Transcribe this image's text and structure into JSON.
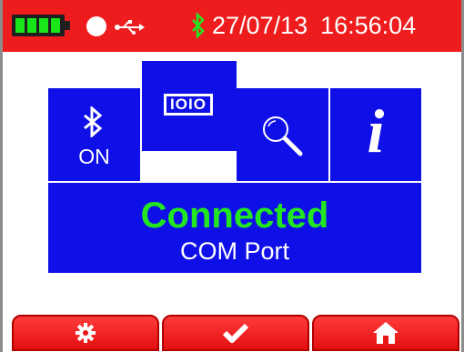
{
  "status_bar": {
    "date": "27/07/13",
    "time": "16:56:04",
    "battery_level": 1.0,
    "icons": [
      "battery-icon",
      "power-dot-icon",
      "usb-icon",
      "bluetooth-icon"
    ]
  },
  "tiles": {
    "bluetooth": {
      "icon": "bluetooth-icon",
      "label": "ON"
    },
    "com_port": {
      "icon": "io-port-icon",
      "glyph_text": "IOIO",
      "selected": true
    },
    "search": {
      "icon": "magnifier-icon"
    },
    "info": {
      "icon": "info-icon",
      "glyph_text": "i"
    }
  },
  "status_panel": {
    "status": "Connected",
    "detail": "COM Port"
  },
  "softkeys": [
    {
      "icon": "gear-icon"
    },
    {
      "icon": "checkmark-icon"
    },
    {
      "icon": "home-icon"
    }
  ],
  "colors": {
    "status_bar": "#ee1c1c",
    "tile_blue": "#0f0fe8",
    "connected_green": "#22e622",
    "battery_green": "#19e619",
    "softkey_red": "#ff3b3b"
  }
}
